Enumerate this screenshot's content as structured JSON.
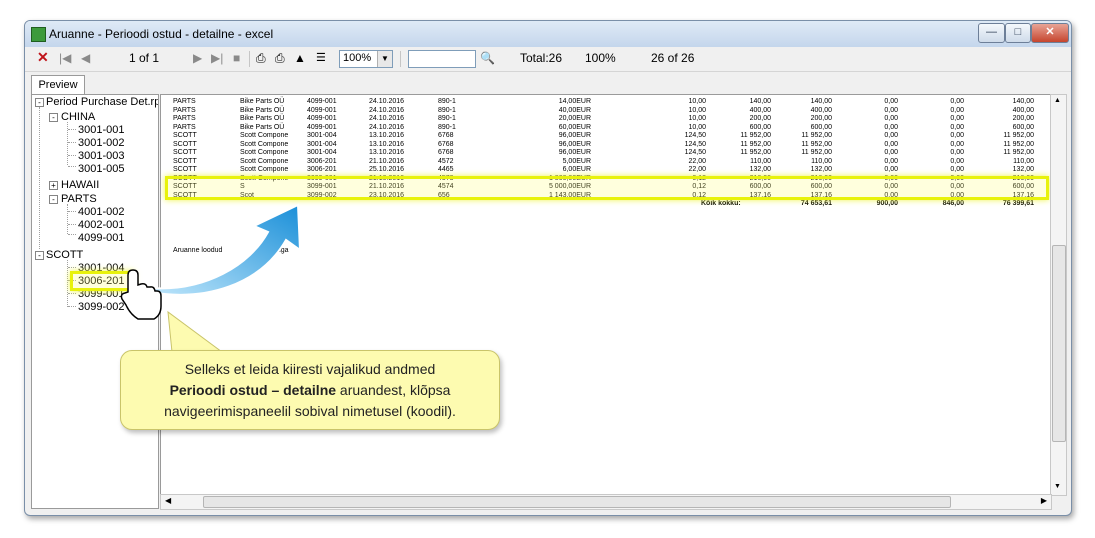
{
  "window": {
    "title": "Aruanne - Perioodi ostud - detailne - excel",
    "controls": [
      "minimize",
      "maximize",
      "close"
    ]
  },
  "toolbar": {
    "page_indicator": "1 of 1",
    "zoom": "100%",
    "total_label": "Total:26",
    "percent": "100%",
    "records": "26 of 26",
    "icons": [
      "close-icon",
      "first-page-icon",
      "prev-page-icon",
      "next-page-icon",
      "last-page-icon",
      "stop-icon",
      "print-icon",
      "print-setup-icon",
      "export-icon",
      "group-tree-icon",
      "zoom-dropdown-icon",
      "search-icon"
    ]
  },
  "tabs": [
    "Preview"
  ],
  "tree": {
    "root": "Period Purchase Det.rpt",
    "groups": [
      {
        "name": "CHINA",
        "expanded": true,
        "items": [
          "3001-001",
          "3001-002",
          "3001-003",
          "3001-005"
        ]
      },
      {
        "name": "HAWAII",
        "expanded": false,
        "items": []
      },
      {
        "name": "PARTS",
        "expanded": true,
        "items": [
          "4001-002",
          "4002-001",
          "4099-001"
        ]
      },
      {
        "name": "SCOTT",
        "expanded": true,
        "items": [
          "3001-004",
          "3006-201",
          "3099-001",
          "3099-002"
        ]
      }
    ]
  },
  "report": {
    "rows": [
      {
        "group": "PARTS",
        "supplier": "Bike Parts OÜ",
        "code": "4099-001",
        "date": "24.10.2016",
        "doc": "890-1",
        "price": "14,00EUR",
        "qty": "10,00",
        "c1": "140,00",
        "c2": "140,00",
        "c3": "0,00",
        "c4": "0,00",
        "c5": "140,00"
      },
      {
        "group": "PARTS",
        "supplier": "Bike Parts OÜ",
        "code": "4099-001",
        "date": "24.10.2016",
        "doc": "890-1",
        "price": "40,00EUR",
        "qty": "10,00",
        "c1": "400,00",
        "c2": "400,00",
        "c3": "0,00",
        "c4": "0,00",
        "c5": "400,00"
      },
      {
        "group": "PARTS",
        "supplier": "Bike Parts OÜ",
        "code": "4099-001",
        "date": "24.10.2016",
        "doc": "890-1",
        "price": "20,00EUR",
        "qty": "10,00",
        "c1": "200,00",
        "c2": "200,00",
        "c3": "0,00",
        "c4": "0,00",
        "c5": "200,00"
      },
      {
        "group": "PARTS",
        "supplier": "Bike Parts OÜ",
        "code": "4099-001",
        "date": "24.10.2016",
        "doc": "890-1",
        "price": "60,00EUR",
        "qty": "10,00",
        "c1": "600,00",
        "c2": "600,00",
        "c3": "0,00",
        "c4": "0,00",
        "c5": "600,00"
      },
      {
        "group": "SCOTT",
        "supplier": "Scott Compone",
        "code": "3001-004",
        "date": "13.10.2016",
        "doc": "6768",
        "price": "96,00EUR",
        "qty": "124,50",
        "c1": "11 952,00",
        "c2": "11 952,00",
        "c3": "0,00",
        "c4": "0,00",
        "c5": "11 952,00"
      },
      {
        "group": "SCOTT",
        "supplier": "Scott Compone",
        "code": "3001-004",
        "date": "13.10.2016",
        "doc": "6768",
        "price": "96,00EUR",
        "qty": "124,50",
        "c1": "11 952,00",
        "c2": "11 952,00",
        "c3": "0,00",
        "c4": "0,00",
        "c5": "11 952,00"
      },
      {
        "group": "SCOTT",
        "supplier": "Scott Compone",
        "code": "3001-004",
        "date": "13.10.2016",
        "doc": "6768",
        "price": "96,00EUR",
        "qty": "124,50",
        "c1": "11 952,00",
        "c2": "11 952,00",
        "c3": "0,00",
        "c4": "0,00",
        "c5": "11 952,00"
      },
      {
        "group": "SCOTT",
        "supplier": "Scott Compone",
        "code": "3006-201",
        "date": "21.10.2016",
        "doc": "4572",
        "price": "5,00EUR",
        "qty": "22,00",
        "c1": "110,00",
        "c2": "110,00",
        "c3": "0,00",
        "c4": "0,00",
        "c5": "110,00"
      },
      {
        "group": "SCOTT",
        "supplier": "Scott Compone",
        "code": "3006-201",
        "date": "25.10.2016",
        "doc": "4465",
        "price": "6,00EUR",
        "qty": "22,00",
        "c1": "132,00",
        "c2": "132,00",
        "c3": "0,00",
        "c4": "0,00",
        "c5": "132,00"
      },
      {
        "group": "SCOTT",
        "supplier": "Scott Compone",
        "code": "3099-001",
        "date": "21.10.2016",
        "doc": "4573",
        "price": "1 800,00EUR",
        "qty": "0,12",
        "c1": "216,00",
        "c2": "216,00",
        "c3": "0,00",
        "c4": "0,00",
        "c5": "216,00"
      },
      {
        "group": "SCOTT",
        "supplier": "S",
        "code": "3099-001",
        "date": "21.10.2016",
        "doc": "4574",
        "price": "5 000,00EUR",
        "qty": "0,12",
        "c1": "600,00",
        "c2": "600,00",
        "c3": "0,00",
        "c4": "0,00",
        "c5": "600,00"
      },
      {
        "group": "SCOTT",
        "supplier": "Scot",
        "code": "3099-002",
        "date": "23.10.2016",
        "doc": "656",
        "price": "1 143,00EUR",
        "qty": "0,12",
        "c1": "137,16",
        "c2": "137,16",
        "c3": "0,00",
        "c4": "0,00",
        "c5": "137,16"
      }
    ],
    "total": {
      "label": "Kõik kokku:",
      "c2": "74 653,61",
      "c3": "900,00",
      "c4": "846,00",
      "c5": "76 399,61"
    },
    "footer_left": "Aruanne loodud",
    "footer_right": "eriga"
  },
  "callout": {
    "line1": "Selleks et leida kiiresti vajalikud andmed",
    "line2_bold": "Perioodi ostud – detailne",
    "line2_rest": " aruandest, klõpsa",
    "line3": "navigeerimispaneelil sobival nimetusel (koodil)."
  },
  "colors": {
    "highlight": "#e8f20c",
    "arrow": "#2e9ee0",
    "callout_bg": "#fdfbb0"
  }
}
